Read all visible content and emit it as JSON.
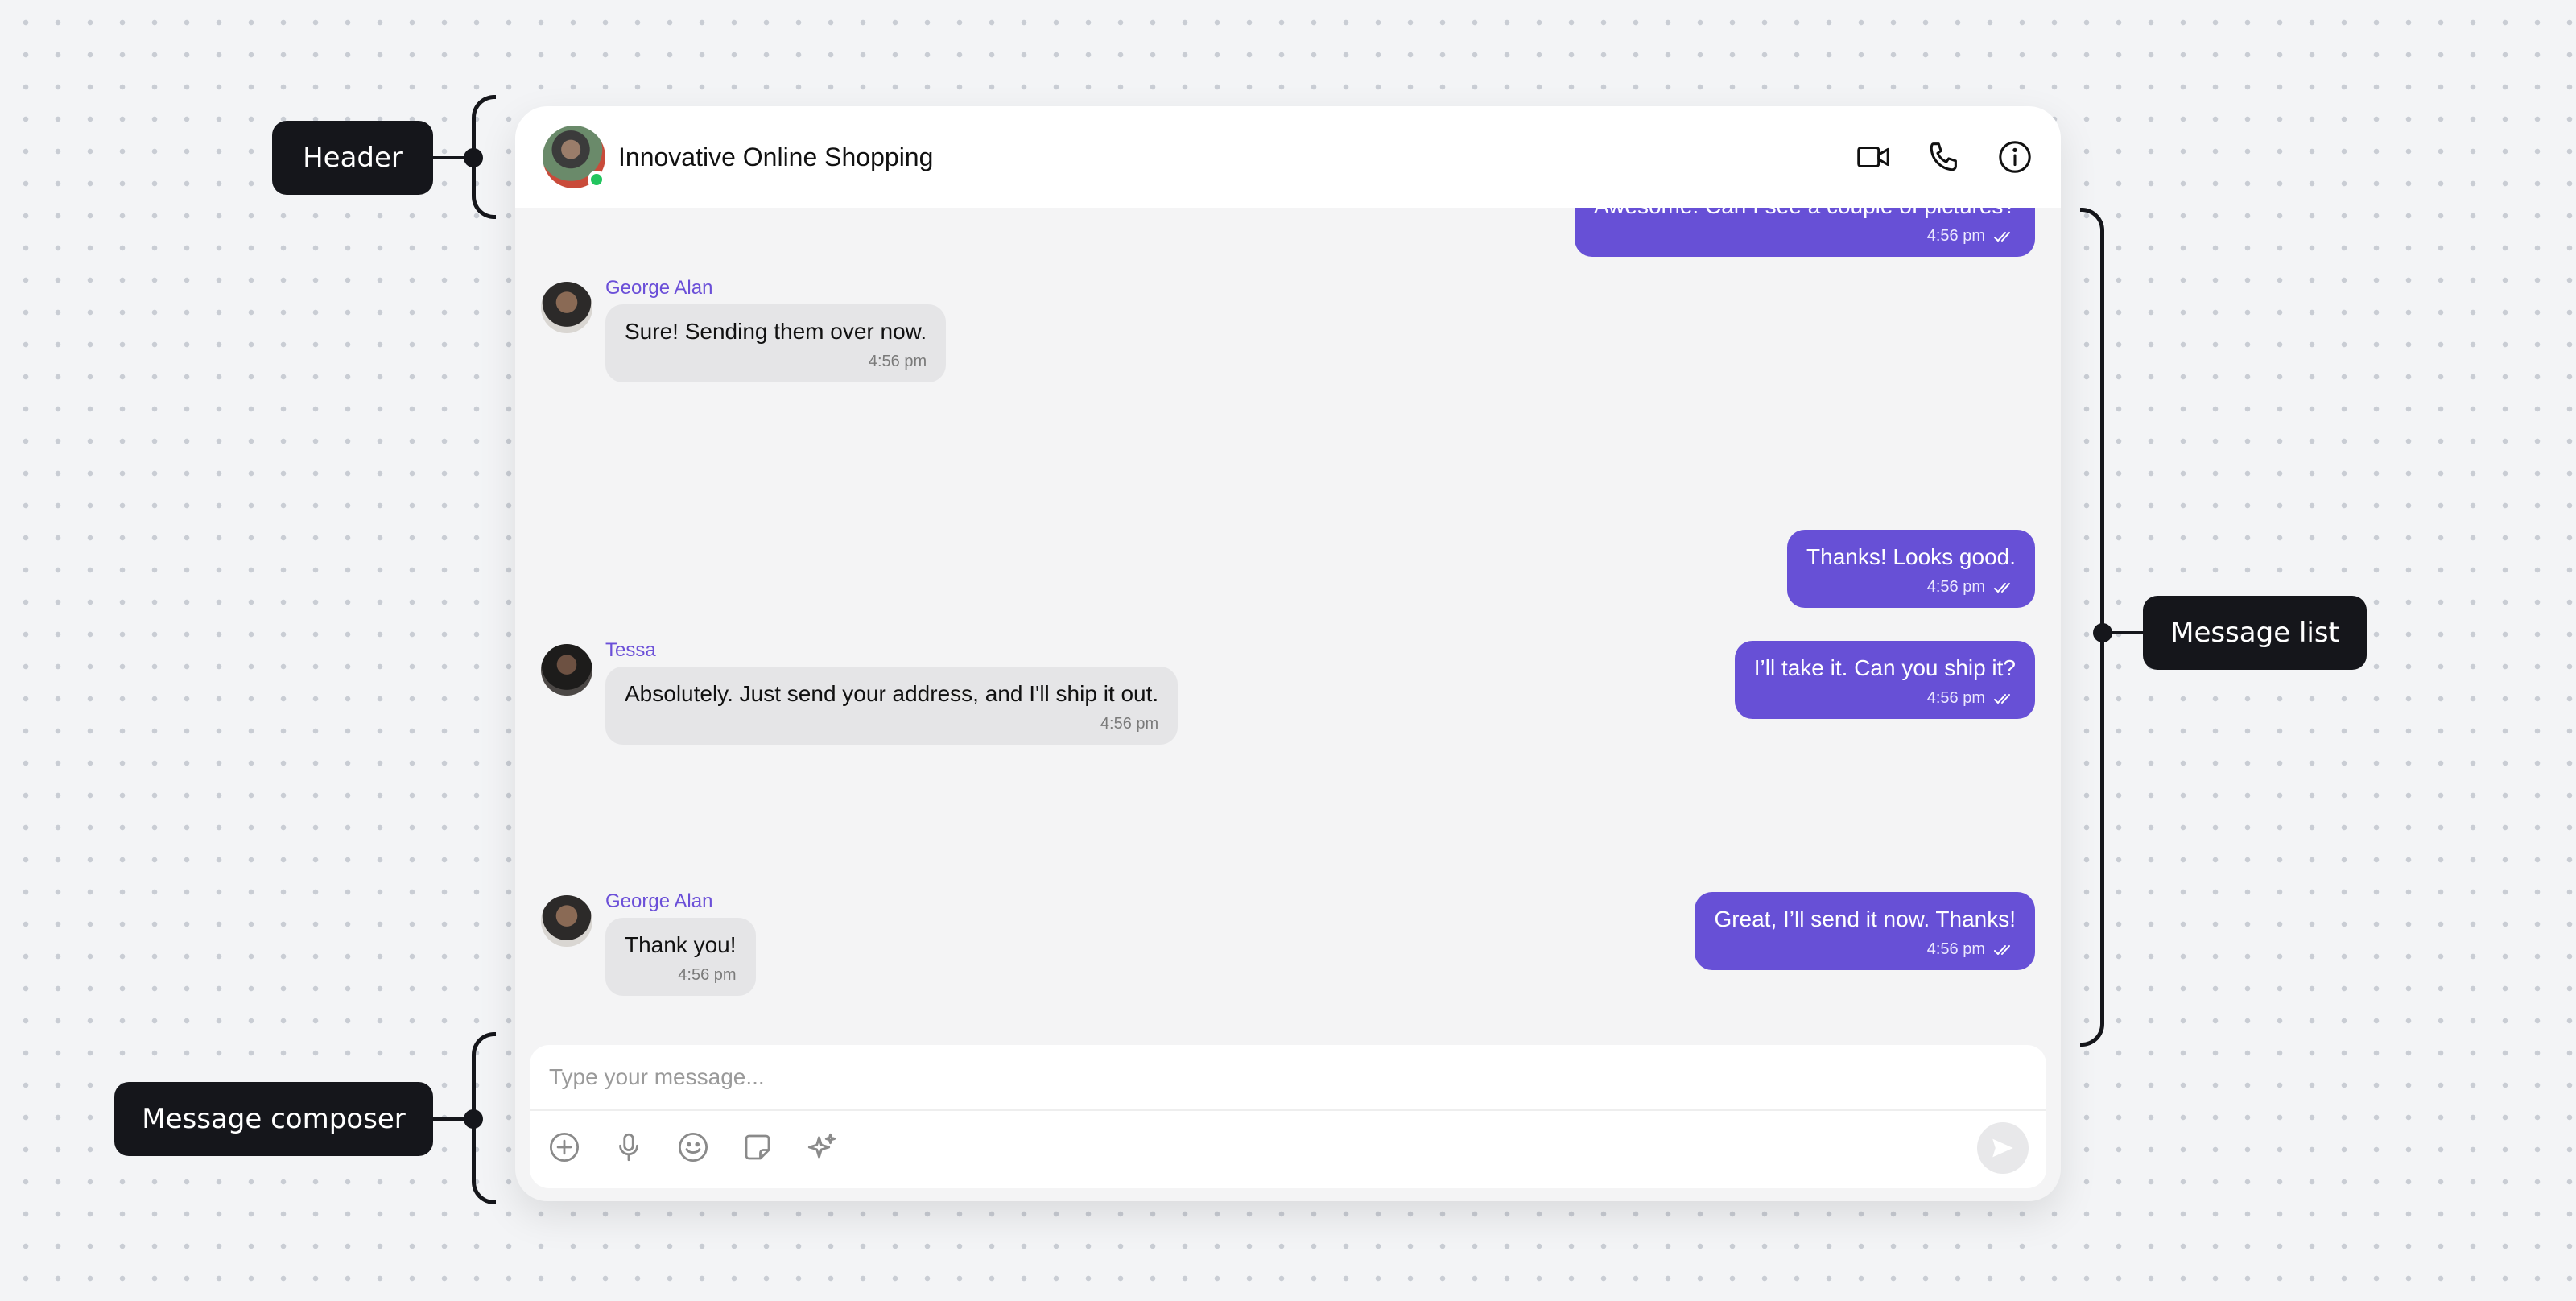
{
  "annotations": {
    "header": "Header",
    "message_list": "Message list",
    "message_composer": "Message composer"
  },
  "chat": {
    "title": "Innovative Online Shopping",
    "header_icons": [
      "video-camera-icon",
      "phone-icon",
      "info-icon"
    ]
  },
  "messages": [
    {
      "direction": "out",
      "text": "Awesome. Can I see a couple of pictures?",
      "time": "4:56 pm"
    },
    {
      "direction": "in",
      "sender": "George Alan",
      "text": "Sure! Sending them over now.",
      "time": "4:56 pm"
    },
    {
      "direction": "out",
      "text": "Thanks! Looks good.",
      "time": "4:56 pm"
    },
    {
      "direction": "out",
      "text": "I’ll take it. Can you ship it?",
      "time": "4:56 pm"
    },
    {
      "direction": "in",
      "sender": "Tessa",
      "text": "Absolutely. Just send your address, and I'll ship it out.",
      "time": "4:56 pm"
    },
    {
      "direction": "out",
      "text": "Great, I’ll send it now. Thanks!",
      "time": "4:56 pm"
    },
    {
      "direction": "in",
      "sender": "George Alan",
      "text": "Thank you!",
      "time": "4:56 pm"
    }
  ],
  "composer": {
    "placeholder": "Type your message...",
    "tools": [
      "add-icon",
      "microphone-icon",
      "emoji-icon",
      "sticker-icon",
      "ai-sparkle-icon"
    ],
    "send_icon": "send-icon"
  },
  "colors": {
    "accent": "#6750d6",
    "sender_name": "#6b4fd8",
    "online": "#22c55e",
    "callout_bg": "#15161b"
  }
}
